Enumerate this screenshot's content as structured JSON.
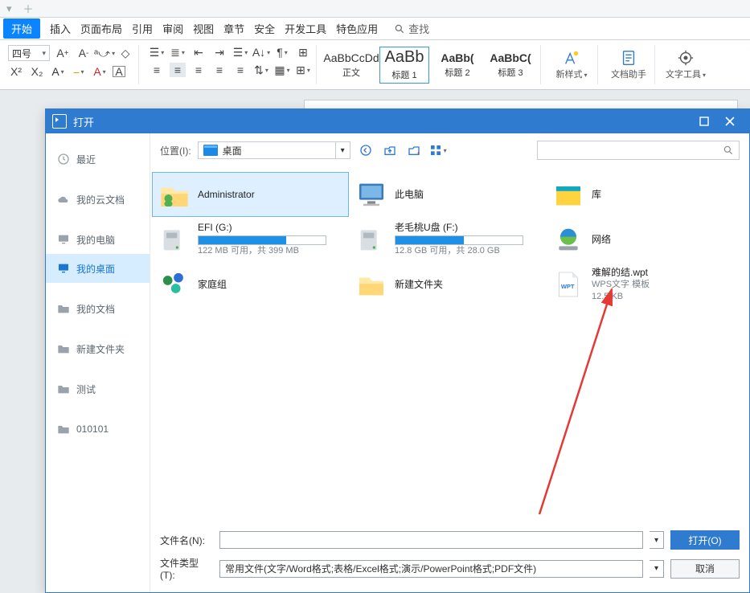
{
  "menu": {
    "start": "开始",
    "items": [
      "插入",
      "页面布局",
      "引用",
      "审阅",
      "视图",
      "章节",
      "安全",
      "开发工具",
      "特色应用"
    ],
    "search": "查找"
  },
  "ribbon": {
    "fontSize": "四号",
    "styles": [
      {
        "prev": "AaBbCcDd",
        "name": "正文"
      },
      {
        "prev": "AaBb",
        "name": "标题 1"
      },
      {
        "prev": "AaBb(",
        "name": "标题 2"
      },
      {
        "prev": "AaBbC(",
        "name": "标题 3"
      }
    ],
    "newStyle": "新样式",
    "docAssist": "文档助手",
    "textTool": "文字工具"
  },
  "dialog": {
    "title": "打开",
    "side": [
      {
        "icon": "clock",
        "label": "最近"
      },
      {
        "icon": "cloud",
        "label": "我的云文档"
      },
      {
        "icon": "pc",
        "label": "我的电脑"
      },
      {
        "icon": "desktop",
        "label": "我的桌面"
      },
      {
        "icon": "folder",
        "label": "我的文档"
      },
      {
        "icon": "folder",
        "label": "新建文件夹"
      },
      {
        "icon": "folder",
        "label": "测试"
      },
      {
        "icon": "folder",
        "label": "010101"
      }
    ],
    "sideSelected": 3,
    "locLabel": "位置(I):",
    "locValue": "桌面",
    "files": {
      "admin": "Administrator",
      "thispc": "此电脑",
      "library": "库",
      "efi": {
        "name": "EFI (G:)",
        "sub": "122 MB 可用，共 399 MB",
        "pct": 69
      },
      "usb": {
        "name": "老毛桃U盘 (F:)",
        "sub": "12.8 GB 可用，共 28.0 GB",
        "pct": 54
      },
      "net": "网络",
      "home": "家庭组",
      "newf": "新建文件夹",
      "wpt": {
        "name": "难解的结.wpt",
        "sub1": "WPS文字 模板",
        "sub2": "12.5 KB"
      }
    },
    "fnameLabel": "文件名(N):",
    "ftypeLabel": "文件类型(T):",
    "ftypeValue": "常用文件(文字/Word格式;表格/Excel格式;演示/PowerPoint格式;PDF文件)",
    "openBtn": "打开(O)",
    "cancelBtn": "取消"
  }
}
